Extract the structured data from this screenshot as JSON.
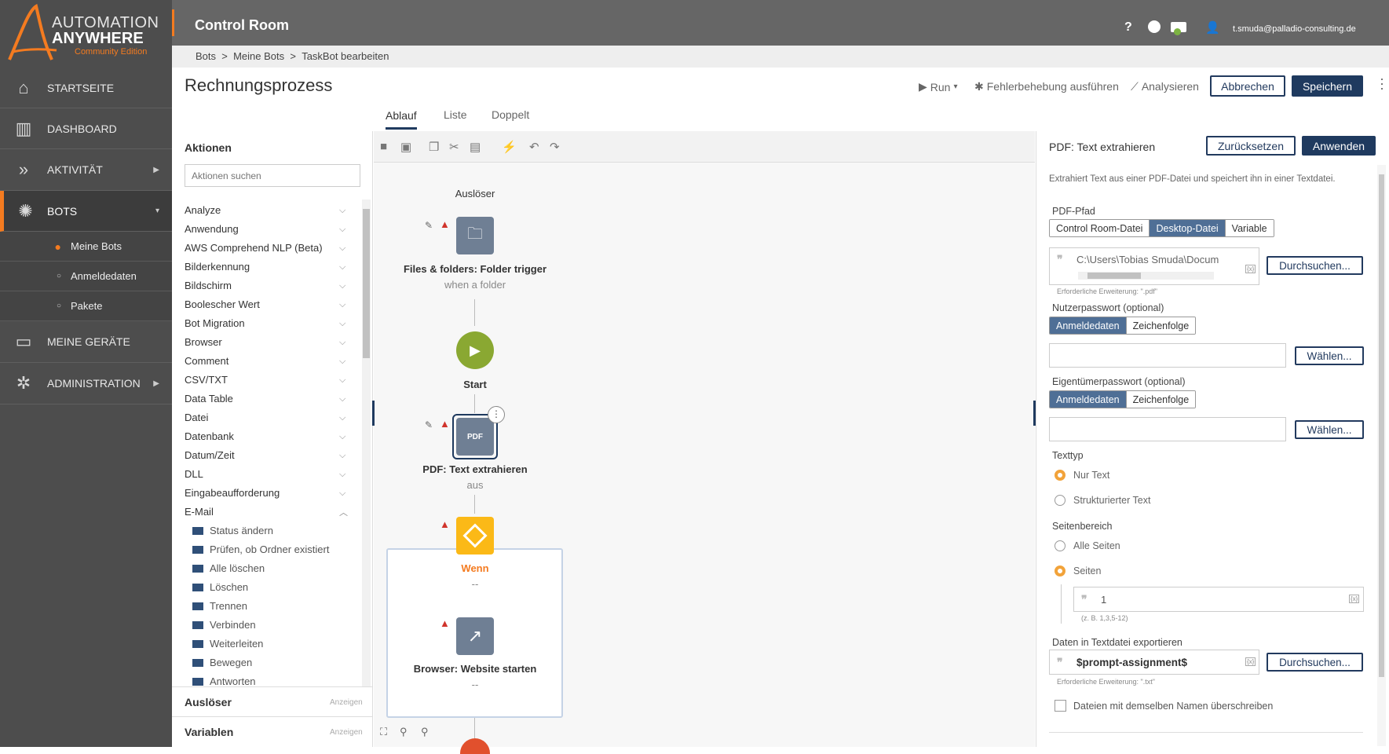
{
  "brand": {
    "line1": "AUTOMATION",
    "line2": "ANYWHERE",
    "edition": "Community Edition"
  },
  "sidebar": {
    "items": [
      {
        "label": "STARTSEITE",
        "icon": "home-icon"
      },
      {
        "label": "DASHBOARD",
        "icon": "dashboard-icon"
      },
      {
        "label": "AKTIVITÄT",
        "icon": "activity-icon"
      },
      {
        "label": "BOTS",
        "icon": "bots-icon"
      },
      {
        "label": "MEINE GERÄTE",
        "icon": "devices-icon"
      },
      {
        "label": "ADMINISTRATION",
        "icon": "admin-icon"
      }
    ],
    "subitems": [
      {
        "label": "Meine Bots"
      },
      {
        "label": "Anmeldedaten"
      },
      {
        "label": "Pakete"
      }
    ]
  },
  "header": {
    "title": "Control Room",
    "user": "t.smuda@palladio-consulting.de"
  },
  "breadcrumb": [
    "Bots",
    ">",
    "Meine Bots",
    ">",
    "TaskBot bearbeiten"
  ],
  "page": {
    "title": "Rechnungsprozess",
    "run": "Run",
    "debug": "Fehlerbehebung ausführen",
    "analyze": "Analysieren",
    "cancel": "Abbrechen",
    "save": "Speichern",
    "tabs": [
      "Ablauf",
      "Liste",
      "Doppelt"
    ]
  },
  "actions": {
    "title": "Aktionen",
    "search_placeholder": "Aktionen suchen",
    "items": [
      "Analyze",
      "Anwendung",
      "AWS Comprehend NLP (Beta)",
      "Bilderkennung",
      "Bildschirm",
      "Boolescher Wert",
      "Bot Migration",
      "Browser",
      "Comment",
      "CSV/TXT",
      "Data Table",
      "Datei",
      "Datenbank",
      "Datum/Zeit",
      "DLL",
      "Eingabeaufforderung",
      "E-Mail"
    ],
    "email_items": [
      "Status ändern",
      "Prüfen, ob Ordner existiert",
      "Alle löschen",
      "Löschen",
      "Trennen",
      "Verbinden",
      "Weiterleiten",
      "Bewegen",
      "Antworten"
    ],
    "triggers": "Auslöser",
    "variables": "Variablen",
    "show": "Anzeigen"
  },
  "flow": {
    "trigger_header": "Auslöser",
    "node1_title": "Files & folders: Folder trigger",
    "node1_sub": "when a folder",
    "start": "Start",
    "node2_title": "PDF: Text extrahieren",
    "node2_sub": "aus",
    "if_title": "Wenn",
    "if_sub": "--",
    "node3_title": "Browser: Website starten",
    "node3_sub": "--"
  },
  "panel": {
    "title": "PDF: Text extrahieren",
    "reset": "Zurücksetzen",
    "apply": "Anwenden",
    "desc": "Extrahiert Text aus einer PDF-Datei und speichert ihn in einer Textdatei.",
    "pdf_path_label": "PDF-Pfad",
    "pdf_path_opts": [
      "Control Room-Datei",
      "Desktop-Datei",
      "Variable"
    ],
    "pdf_path_value": "C:\\Users\\Tobias Smuda\\Docum",
    "browse": "Durchsuchen...",
    "ext_pdf": "Erforderliche Erweiterung: \".pdf\"",
    "user_pw_label": "Nutzerpasswort (optional)",
    "cred_opts": [
      "Anmeldedaten",
      "Zeichenfolge"
    ],
    "choose": "Wählen...",
    "owner_pw_label": "Eigentümerpasswort (optional)",
    "text_type_label": "Texttyp",
    "text_type_opts": [
      "Nur Text",
      "Strukturierter Text"
    ],
    "page_range_label": "Seitenbereich",
    "page_range_opts": [
      "Alle Seiten",
      "Seiten"
    ],
    "pages_value": "1",
    "pages_hint": "(z. B. 1,3,5-12)",
    "export_label": "Daten in Textdatei exportieren",
    "export_value": "$prompt-assignment$",
    "ext_txt": "Erforderliche Erweiterung: \".txt\"",
    "overwrite": "Dateien mit demselben Namen überschreiben"
  },
  "colors": {
    "accent": "#f47b20",
    "navy": "#1f3a5f",
    "trigger_yellow": "#fbb917",
    "start_green": "#8aa832",
    "sidebar": "#4d4d4d"
  }
}
